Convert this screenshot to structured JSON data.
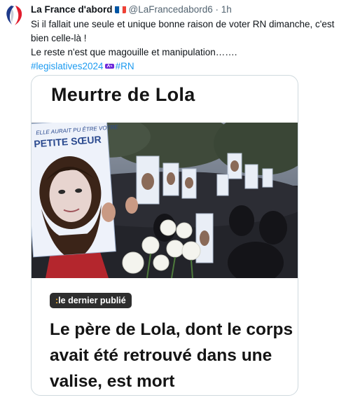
{
  "tweet": {
    "author_name": "La France d'abord",
    "handle": "@LaFrancedabord6",
    "separator": "·",
    "time": "1h",
    "flag_colors": [
      "#0055a4",
      "#ffffff",
      "#ef4135"
    ],
    "avatar_icon": "france-map-logo-icon",
    "text_lines": [
      "Si il fallait une seule et unique bonne raison de voter RN dimanche, c'est bien celle-là !",
      "Le reste n'est que magouille et manipulation……."
    ],
    "hashtag_1": "#legislatives2024",
    "hashtag_2": "#RN",
    "hashtag_emoji_icon": "legislatives-flame-icon"
  },
  "card": {
    "title": "Meurtre de Lola",
    "photo_signs_text": "ELLE AURAIT PU ÊTRE VOTRE PETITE SŒUR",
    "badge_colon": ":",
    "badge_text": "le dernier publié",
    "headline": "Le père de Lola, dont le corps avait été retrouvé dans une valise, est mort"
  }
}
